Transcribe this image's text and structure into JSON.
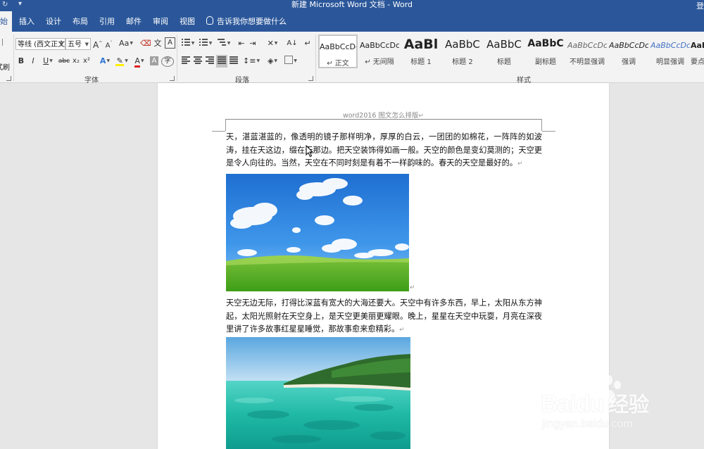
{
  "window": {
    "title": "新建 Microsoft Word 文档 - Word",
    "login": "登"
  },
  "tabs": [
    {
      "label": "开始",
      "visible_label": "始",
      "active": true
    },
    {
      "label": "插入"
    },
    {
      "label": "设计"
    },
    {
      "label": "布局"
    },
    {
      "label": "引用"
    },
    {
      "label": "邮件"
    },
    {
      "label": "审阅"
    },
    {
      "label": "视图"
    }
  ],
  "tell_me": "告诉我你想要做什么",
  "ribbon": {
    "clipboard": {
      "format_painter_label": "式刷"
    },
    "font": {
      "group_label": "字体",
      "font_name": "等线 (西文正文",
      "font_size": "五号",
      "grow": "A",
      "shrink": "A",
      "change_case": "Aa",
      "bold": "B",
      "italic": "I",
      "underline": "U",
      "strike": "abc",
      "subscript": "x₂",
      "superscript": "x²",
      "font_color_letter": "A",
      "char_shade": "A",
      "char_border": "A",
      "phonetic": "文"
    },
    "paragraph": {
      "group_label": "段落"
    },
    "styles": {
      "group_label": "样式",
      "items": [
        {
          "sample": "AaBbCcDc",
          "name": "↵ 正文",
          "selected": true
        },
        {
          "sample": "AaBbCcDc",
          "name": "↵ 无间隔"
        },
        {
          "sample": "AaBl",
          "name": "标题 1"
        },
        {
          "sample": "AaBbC",
          "name": "标题 2"
        },
        {
          "sample": "AaBbC",
          "name": "标题"
        },
        {
          "sample": "AaBbC",
          "name": "副标题"
        },
        {
          "sample": "AaBbCcDc",
          "name": "不明显强调"
        },
        {
          "sample": "AaBbCcDc",
          "name": "强调"
        },
        {
          "sample": "AaBbCcDc",
          "name": "明显强调"
        },
        {
          "sample": "AaBl",
          "name": "要点"
        }
      ]
    }
  },
  "document": {
    "header": "word2016 图文怎么排版",
    "paragraph_mark": "↵",
    "paragraph1": "天，湛蓝湛蓝的，像透明的镜子那样明净，厚厚的白云，一团团的如棉花，一阵阵的如波涛，挂在天这边，缀在天那边。把天空装饰得如画一般。天空的颜色是变幻莫测的；天空更是令人向往的。当然，天空在不同时刻是有着不一样韵味的。春天的天空是最好的。",
    "paragraph2": "天空无边无际，打得比深蓝有宽大的大海还要大。天空中有许多东西，早上，太阳从东方神起，太阳光照射在天空身上，是天空更美丽更耀眼。晚上，星星在天空中玩耍，月亮在深夜里讲了许多故事红星星睡觉，那故事愈来愈精彩。"
  },
  "watermark": {
    "brand": "Baidu",
    "brand_cn": "经验",
    "url": "jingyan.baidu.com"
  },
  "colors": {
    "accent": "#2b579a",
    "ribbon_bg": "#f3f3f3",
    "canvas_bg": "#e6e6e6"
  }
}
